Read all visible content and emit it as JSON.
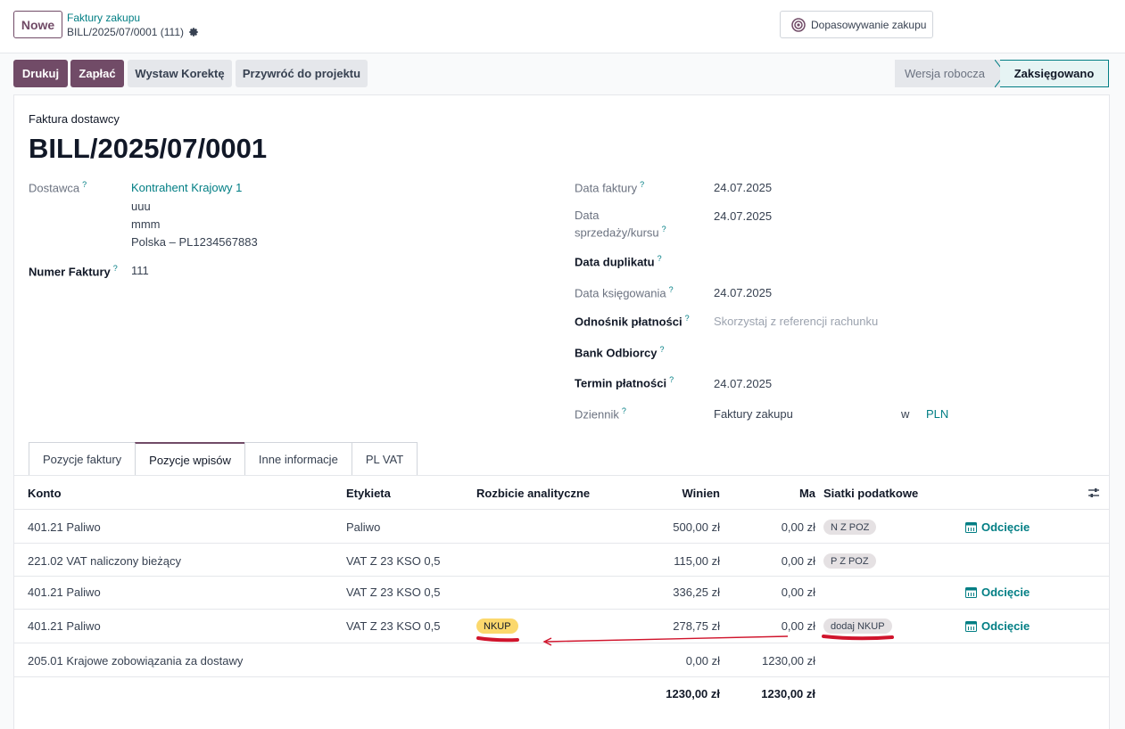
{
  "topbar": {
    "new_label": "Nowe",
    "breadcrumb_parent": "Faktury zakupu",
    "breadcrumb_current": "BILL/2025/07/0001 (111)",
    "match_label": "Dopasowywanie zakupu"
  },
  "actions": {
    "print": "Drukuj",
    "pay": "Zapłać",
    "credit_note": "Wystaw Korektę",
    "reset_draft": "Przywróć do projektu"
  },
  "status": {
    "draft": "Wersja robocza",
    "posted": "Zaksięgowano"
  },
  "form": {
    "doc_type": "Faktura dostawcy",
    "title": "BILL/2025/07/0001",
    "vendor_label": "Dostawca",
    "vendor_name": "Kontrahent Krajowy 1",
    "vendor_line1": "uuu",
    "vendor_line2": "mmm",
    "vendor_line3": "Polska – PL1234567883",
    "bill_ref_label": "Numer Faktury",
    "bill_ref": "111",
    "invoice_date_label": "Data faktury",
    "invoice_date": "24.07.2025",
    "sale_date_label_1": "Data",
    "sale_date_label_2": "sprzedaży/kursu",
    "sale_date": "24.07.2025",
    "dup_date_label": "Data duplikatu",
    "acc_date_label": "Data księgowania",
    "acc_date": "24.07.2025",
    "pay_ref_label": "Odnośnik płatności",
    "pay_ref_placeholder": "Skorzystaj z referencji rachunku",
    "bank_label": "Bank Odbiorcy",
    "due_label": "Termin płatności",
    "due_date": "24.07.2025",
    "journal_label": "Dziennik",
    "journal": "Faktury zakupu",
    "journal_in": "w",
    "currency": "PLN",
    "help_mark": "?"
  },
  "tabs": [
    "Pozycje faktury",
    "Pozycje wpisów",
    "Inne informacje",
    "PL VAT"
  ],
  "active_tab": 1,
  "table": {
    "headers": {
      "account": "Konto",
      "label": "Etykieta",
      "analytic": "Rozbicie analityczne",
      "debit": "Winien",
      "credit": "Ma",
      "tax_grids": "Siatki podatkowe"
    },
    "rows": [
      {
        "account": "401.21 Paliwo",
        "label": "Paliwo",
        "analytic": "",
        "debit": "500,00 zł",
        "credit": "0,00 zł",
        "grid": "N Z POZ",
        "cutoff": "Odcięcie"
      },
      {
        "account": "221.02 VAT naliczony bieżący",
        "label": "VAT Z 23 KSO 0,5",
        "analytic": "",
        "debit": "115,00 zł",
        "credit": "0,00 zł",
        "grid": "P Z POZ",
        "cutoff": ""
      },
      {
        "account": "401.21 Paliwo",
        "label": "VAT Z 23 KSO 0,5",
        "analytic": "",
        "debit": "336,25 zł",
        "credit": "0,00 zł",
        "grid": "",
        "cutoff": "Odcięcie"
      },
      {
        "account": "401.21 Paliwo",
        "label": "VAT Z 23 KSO 0,5",
        "analytic": "NKUP",
        "debit": "278,75 zł",
        "credit": "0,00 zł",
        "grid": "dodaj NKUP",
        "cutoff": "Odcięcie"
      },
      {
        "account": "205.01 Krajowe zobowiązania za dostawy",
        "label": "",
        "analytic": "",
        "debit": "0,00 zł",
        "credit": "1230,00 zł",
        "grid": "",
        "cutoff": ""
      }
    ],
    "total_debit": "1230,00 zł",
    "total_credit": "1230,00 zł"
  },
  "colors": {
    "brand": "#714b67",
    "link": "#017e84",
    "annotation": "#d0142c"
  }
}
